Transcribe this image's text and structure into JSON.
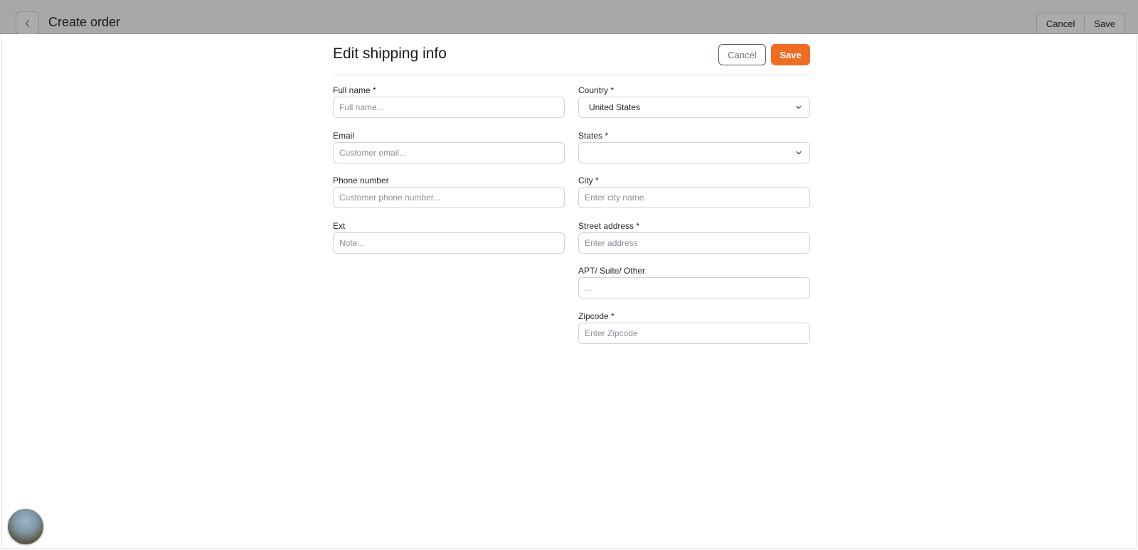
{
  "topbar": {
    "title": "Create order",
    "cancel_label": "Cancel",
    "save_label": "Save"
  },
  "modal": {
    "title": "Edit shipping info",
    "cancel_label": "Cancel",
    "save_label": "Save",
    "accent_color": "#ee6d24"
  },
  "left_fields": [
    {
      "label": "Full name *",
      "placeholder": "Full name...",
      "value": ""
    },
    {
      "label": "Email",
      "placeholder": "Customer email...",
      "value": ""
    },
    {
      "label": "Phone number",
      "placeholder": "Customer phone number...",
      "value": ""
    },
    {
      "label": "Ext",
      "placeholder": "Note...",
      "value": ""
    }
  ],
  "right_fields": [
    {
      "label": "Country *",
      "type": "select",
      "value": "United States"
    },
    {
      "label": "States *",
      "type": "select",
      "value": ""
    },
    {
      "label": "City *",
      "placeholder": "Enter city name",
      "value": ""
    },
    {
      "label": "Street address *",
      "placeholder": "Enter address",
      "value": ""
    },
    {
      "label": "APT/ Suite/ Other",
      "placeholder": "...",
      "value": ""
    },
    {
      "label": "Zipcode *",
      "placeholder": "Enter Zipcode",
      "value": ""
    }
  ],
  "icons": {
    "back": "chevron-left-icon",
    "select": "chevron-down-icon"
  }
}
